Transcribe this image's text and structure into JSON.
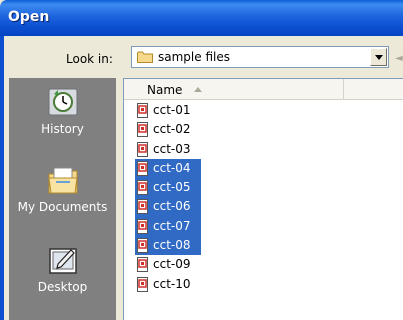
{
  "window": {
    "title": "Open"
  },
  "look_in": {
    "label": "Look in:",
    "value": "sample files"
  },
  "places": [
    {
      "label": "History",
      "icon": "history-icon"
    },
    {
      "label": "My Documents",
      "icon": "my-documents-icon"
    },
    {
      "label": "Desktop",
      "icon": "desktop-icon"
    }
  ],
  "file_list": {
    "column_name": "Name",
    "files": [
      {
        "name": "cct-01",
        "selected": false
      },
      {
        "name": "cct-02",
        "selected": false
      },
      {
        "name": "cct-03",
        "selected": false
      },
      {
        "name": "cct-04",
        "selected": true
      },
      {
        "name": "cct-05",
        "selected": true
      },
      {
        "name": "cct-06",
        "selected": true
      },
      {
        "name": "cct-07",
        "selected": true
      },
      {
        "name": "cct-08",
        "selected": true
      },
      {
        "name": "cct-09",
        "selected": false
      },
      {
        "name": "cct-10",
        "selected": false
      }
    ]
  },
  "colors": {
    "title_bar": "#0b4fd0",
    "selection": "#316ac5",
    "places_bar": "#808080",
    "dialog_bg": "#ece9d8"
  }
}
